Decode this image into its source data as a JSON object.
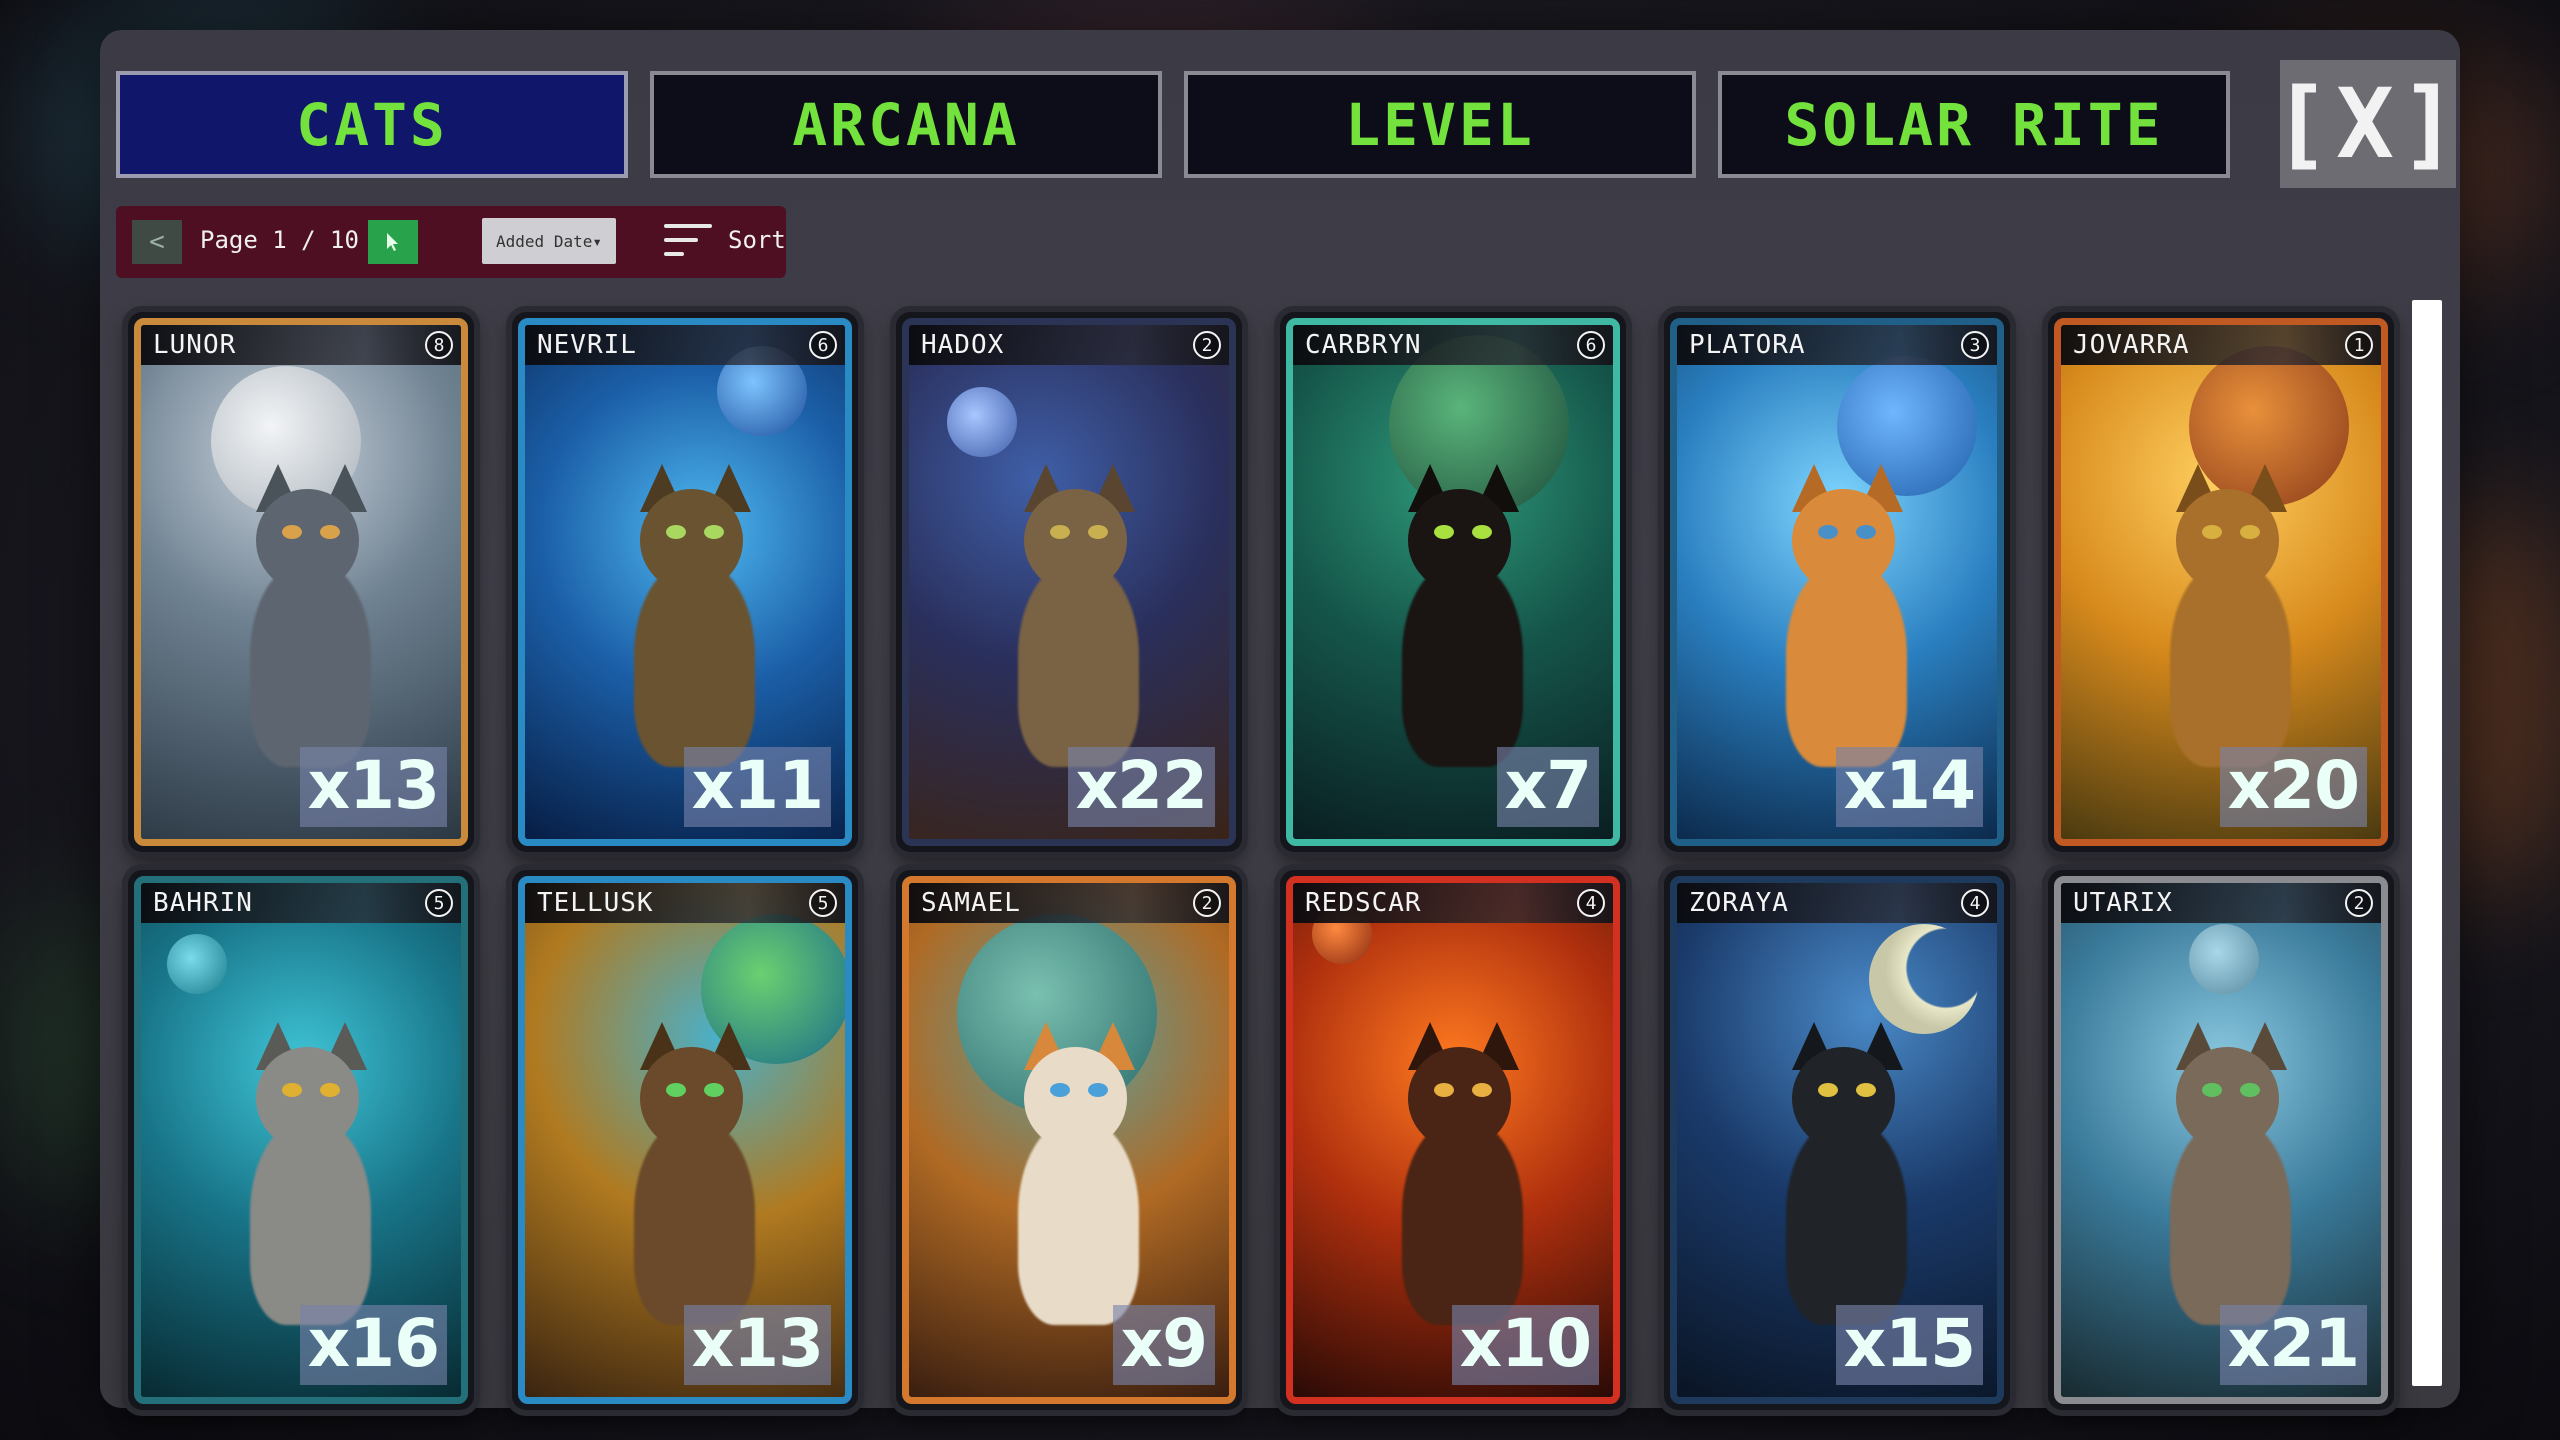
{
  "tabs": [
    {
      "label": "CATS",
      "active": true
    },
    {
      "label": "ARCANA",
      "active": false
    },
    {
      "label": "LEVEL",
      "active": false
    },
    {
      "label": "SOLAR RITE",
      "active": false
    }
  ],
  "close_label": "[X]",
  "pager": {
    "prev_label": "<",
    "next_icon": "cursor-arrow-icon",
    "page_text": "Page 1 / 10",
    "current_page": 1,
    "total_pages": 10,
    "sort_select_value": "Added Date",
    "sort_label": "Sort",
    "sort_icon": "sort-lines-icon"
  },
  "colors": {
    "tab_text": "#74e23c",
    "tab_active_bg": "#10166a",
    "pager_bg": "#4e0f22",
    "next_btn": "#28a34b"
  },
  "cards": [
    {
      "name": "LUNOR",
      "level": "8",
      "count": "x13",
      "frame": "#c98a3c",
      "theme": "silver-moon"
    },
    {
      "name": "NEVRIL",
      "level": "6",
      "count": "x11",
      "frame": "#2a8bc4",
      "theme": "blue-swirl"
    },
    {
      "name": "HADOX",
      "level": "2",
      "count": "x22",
      "frame": "#2c3456",
      "theme": "night-brown"
    },
    {
      "name": "CARBRYN",
      "level": "6",
      "count": "x7",
      "frame": "#3fb8a4",
      "theme": "teal-black"
    },
    {
      "name": "PLATORA",
      "level": "3",
      "count": "x14",
      "frame": "#1f5f88",
      "theme": "orange-kitten"
    },
    {
      "name": "JOVARRA",
      "level": "1",
      "count": "x20",
      "frame": "#c05a22",
      "theme": "golden"
    },
    {
      "name": "BAHRIN",
      "level": "5",
      "count": "x16",
      "frame": "#24707a",
      "theme": "teal-trident"
    },
    {
      "name": "TELLUSK",
      "level": "5",
      "count": "x13",
      "frame": "#2a8bc4",
      "theme": "earth-amber"
    },
    {
      "name": "SAMAEL",
      "level": "2",
      "count": "x9",
      "frame": "#d4782e",
      "theme": "calico-saturn"
    },
    {
      "name": "REDSCAR",
      "level": "4",
      "count": "x10",
      "frame": "#d23020",
      "theme": "fire"
    },
    {
      "name": "ZORAYA",
      "level": "4",
      "count": "x15",
      "frame": "#1d3a5c",
      "theme": "crescent"
    },
    {
      "name": "UTARIX",
      "level": "2",
      "count": "x21",
      "frame": "#8a8c92",
      "theme": "uranus"
    }
  ]
}
